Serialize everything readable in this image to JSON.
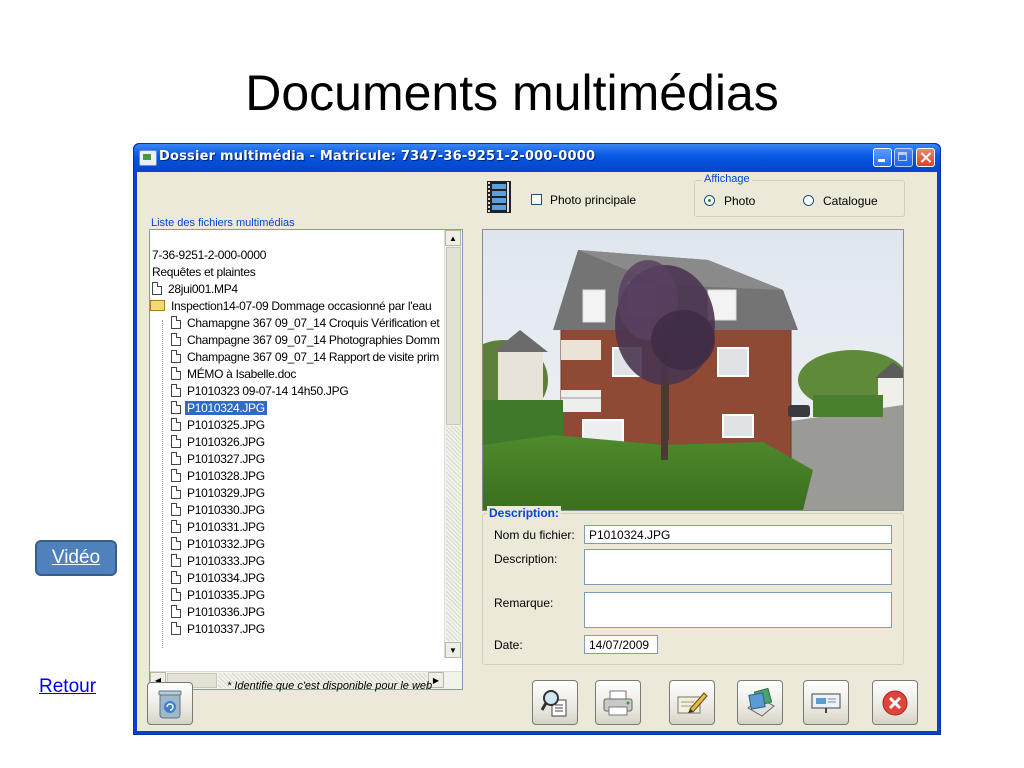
{
  "slide": {
    "title": "Documents multimédias",
    "video_button": "Vidéo",
    "retour_link": "Retour"
  },
  "window": {
    "title": "Dossier multimédia - Matricule: 7347-36-9251-2-000-0000",
    "list_label": "Liste des fichiers multimédias",
    "tree": [
      {
        "label": "7-36-9251-2-000-0000",
        "icon": "none"
      },
      {
        "label": "Requêtes et plaintes",
        "icon": "none"
      },
      {
        "label": "28jui001.MP4",
        "icon": "file-icon"
      },
      {
        "label": "Inspection14-07-09 Dommage occasionné par l'eau",
        "icon": "folder-open-icon"
      },
      {
        "label": "Chamapgne 367 09_07_14 Croquis Vérification et",
        "icon": "file-icon"
      },
      {
        "label": "Champagne 367 09_07_14 Photographies Domm",
        "icon": "file-icon"
      },
      {
        "label": "Champagne 367 09_07_14 Rapport de visite prim",
        "icon": "file-icon"
      },
      {
        "label": "MÉMO à Isabelle.doc",
        "icon": "file-icon"
      },
      {
        "label": "P1010323 09-07-14 14h50.JPG",
        "icon": "file-icon"
      },
      {
        "label": "P1010324.JPG",
        "icon": "file-icon",
        "selected": true
      },
      {
        "label": "P1010325.JPG",
        "icon": "file-icon"
      },
      {
        "label": "P1010326.JPG",
        "icon": "file-icon"
      },
      {
        "label": "P1010327.JPG",
        "icon": "file-icon"
      },
      {
        "label": "P1010328.JPG",
        "icon": "file-icon"
      },
      {
        "label": "P1010329.JPG",
        "icon": "file-icon"
      },
      {
        "label": "P1010330.JPG",
        "icon": "file-icon"
      },
      {
        "label": "P1010331.JPG",
        "icon": "file-icon"
      },
      {
        "label": "P1010332.JPG",
        "icon": "file-icon"
      },
      {
        "label": "P1010333.JPG",
        "icon": "file-icon"
      },
      {
        "label": "P1010334.JPG",
        "icon": "file-icon"
      },
      {
        "label": "P1010335.JPG",
        "icon": "file-icon"
      },
      {
        "label": "P1010336.JPG",
        "icon": "file-icon"
      },
      {
        "label": "P1010337.JPG",
        "icon": "file-icon"
      }
    ],
    "photo_principale_label": "Photo principale",
    "affichage": {
      "legend": "Affichage",
      "options": [
        "Photo",
        "Catalogue"
      ],
      "selected": "Photo"
    },
    "description_group": {
      "legend": "Description:",
      "nom_label": "Nom du fichier:",
      "nom_value": "P1010324.JPG",
      "description_label": "Description:",
      "description_value": "",
      "remarque_label": "Remarque:",
      "remarque_value": "",
      "date_label": "Date:",
      "date_value": "14/07/2009"
    },
    "note": "* Identifie que c'est disponible pour le web",
    "toolbar_icons": [
      "trash-icon",
      "search-document-icon",
      "printer-icon",
      "edit-document-icon",
      "export-icon",
      "presentation-icon",
      "close-icon"
    ]
  },
  "colors": {
    "titlebar": "#0a5ae6",
    "client_bg": "#ece9d8",
    "group_label": "#0046d5",
    "selection": "#316ac5",
    "video_button": "#4f81bd"
  }
}
